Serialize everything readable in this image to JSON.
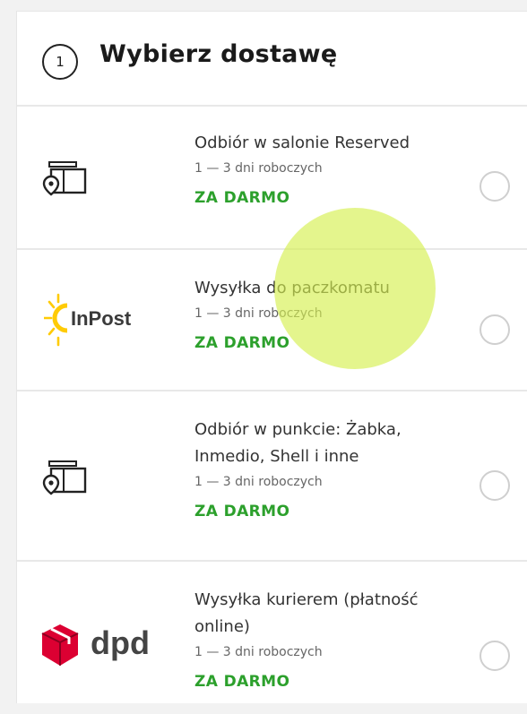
{
  "header": {
    "step_number": "1",
    "title": "Wybierz dostawę"
  },
  "options": [
    {
      "name": "Odbiór w salonie Reserved",
      "days": "1 — 3 dni roboczych",
      "price": "ZA DARMO",
      "icon": "store-pickup-icon",
      "selected": false
    },
    {
      "name": "Wysyłka do paczkomatu",
      "days": "1 — 3 dni roboczych",
      "price": "ZA DARMO",
      "icon": "inpost-logo",
      "logo_text": "InPost",
      "selected": false
    },
    {
      "name_line1": "Odbiór w punkcie: Żabka,",
      "name_line2": "Inmedio, Shell i inne",
      "days": "1 — 3 dni roboczych",
      "price": "ZA DARMO",
      "icon": "pickup-point-icon",
      "selected": false
    },
    {
      "name_line1": "Wysyłka kurierem (płatność",
      "name_line2": "online)",
      "days": "1 — 3 dni roboczych",
      "price": "ZA DARMO",
      "icon": "dpd-logo",
      "logo_text": "dpd",
      "selected": false
    }
  ],
  "colors": {
    "price_green": "#2ca02c",
    "highlight": "#d6f050",
    "dpd_red": "#dc0032",
    "inpost_yellow": "#ffcb05"
  }
}
